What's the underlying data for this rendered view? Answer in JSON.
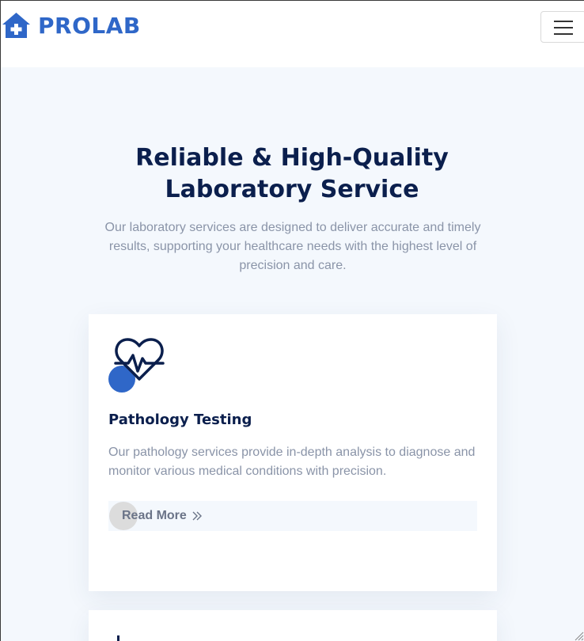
{
  "brand": {
    "name": "PROLAB",
    "color": "#2f67c8",
    "icon": "home-plus-icon"
  },
  "nav": {
    "menu_icon": "hamburger-icon"
  },
  "hero": {
    "title_line1": "Reliable & High-Quality",
    "title_line2": "Laboratory Service",
    "subtitle": "Our laboratory services are designed to deliver accurate and timely results, supporting your healthcare needs with the highest level of precision and care."
  },
  "cards": [
    {
      "icon": "heartbeat-icon",
      "title": "Pathology Testing",
      "text": "Our pathology services provide in-depth analysis to diagnose and monitor various medical conditions with precision.",
      "link_label": "Read More",
      "link_icon": "double-chevron-right-icon"
    }
  ],
  "colors": {
    "heading": "#0b1f4d",
    "body_text": "#8a94a8",
    "accent": "#2f67c8",
    "background": "#f4f8fd"
  }
}
